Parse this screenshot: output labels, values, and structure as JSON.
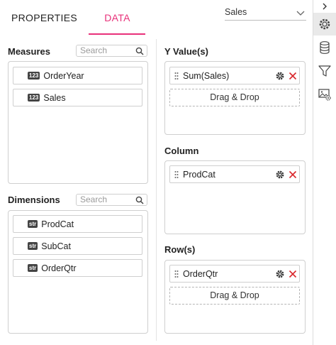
{
  "tabs": [
    {
      "label": "PROPERTIES"
    },
    {
      "label": "DATA"
    }
  ],
  "combo": {
    "value": "Sales"
  },
  "measures": {
    "title": "Measures",
    "search_placeholder": "Search",
    "items": [
      {
        "badge": "123",
        "label": "OrderYear"
      },
      {
        "badge": "123",
        "label": "Sales"
      }
    ]
  },
  "dimensions": {
    "title": "Dimensions",
    "search_placeholder": "Search",
    "items": [
      {
        "badge": "str",
        "label": "ProdCat"
      },
      {
        "badge": "str",
        "label": "SubCat"
      },
      {
        "badge": "str",
        "label": "OrderQtr"
      }
    ]
  },
  "y_values": {
    "title": "Y Value(s)",
    "items": [
      {
        "label": "Sum(Sales)"
      }
    ],
    "drag_label": "Drag & Drop"
  },
  "column": {
    "title": "Column",
    "items": [
      {
        "label": "ProdCat"
      }
    ]
  },
  "rows": {
    "title": "Row(s)",
    "items": [
      {
        "label": "OrderQtr"
      }
    ],
    "drag_label": "Drag & Drop"
  },
  "colors": {
    "accent": "#e8317a",
    "remove": "#d9262b"
  },
  "toolbar_icons": [
    "chevron-right-icon",
    "gear-icon",
    "database-icon",
    "filter-icon",
    "image-settings-icon"
  ]
}
